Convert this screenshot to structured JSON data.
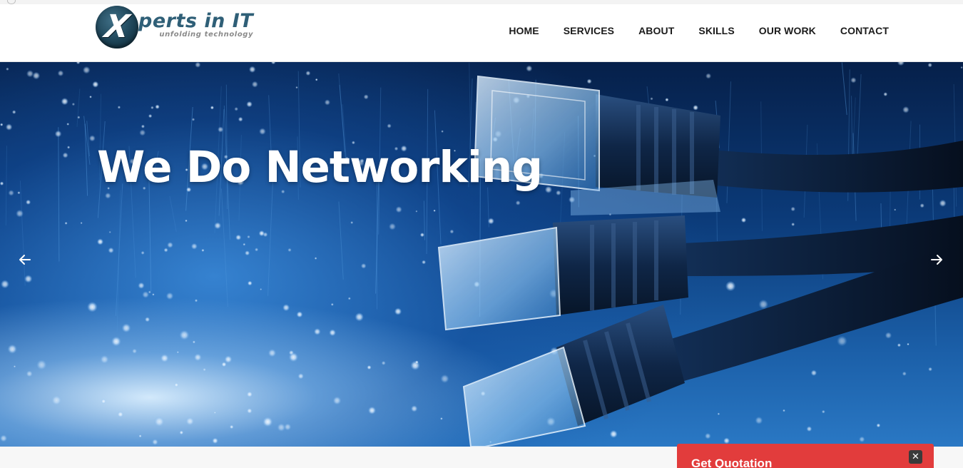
{
  "brand": {
    "logo_mark": "X",
    "logo_word": "perts in IT",
    "tagline": "unfolding technology"
  },
  "nav": {
    "items": [
      {
        "label": "HOME"
      },
      {
        "label": "SERVICES"
      },
      {
        "label": "ABOUT"
      },
      {
        "label": "SKILLS"
      },
      {
        "label": "OUR WORK"
      },
      {
        "label": "CONTACT"
      }
    ]
  },
  "hero": {
    "title": "We Do Networking",
    "prev_icon": "arrow-left-icon",
    "next_icon": "arrow-right-icon"
  },
  "quote_widget": {
    "title": "Get Quotation",
    "close_icon": "close-icon",
    "close_glyph": "✕"
  },
  "colors": {
    "accent_red": "#e23c3c",
    "brand_blue": "#2f5f77",
    "hero_blue": "#1b5fa8"
  }
}
